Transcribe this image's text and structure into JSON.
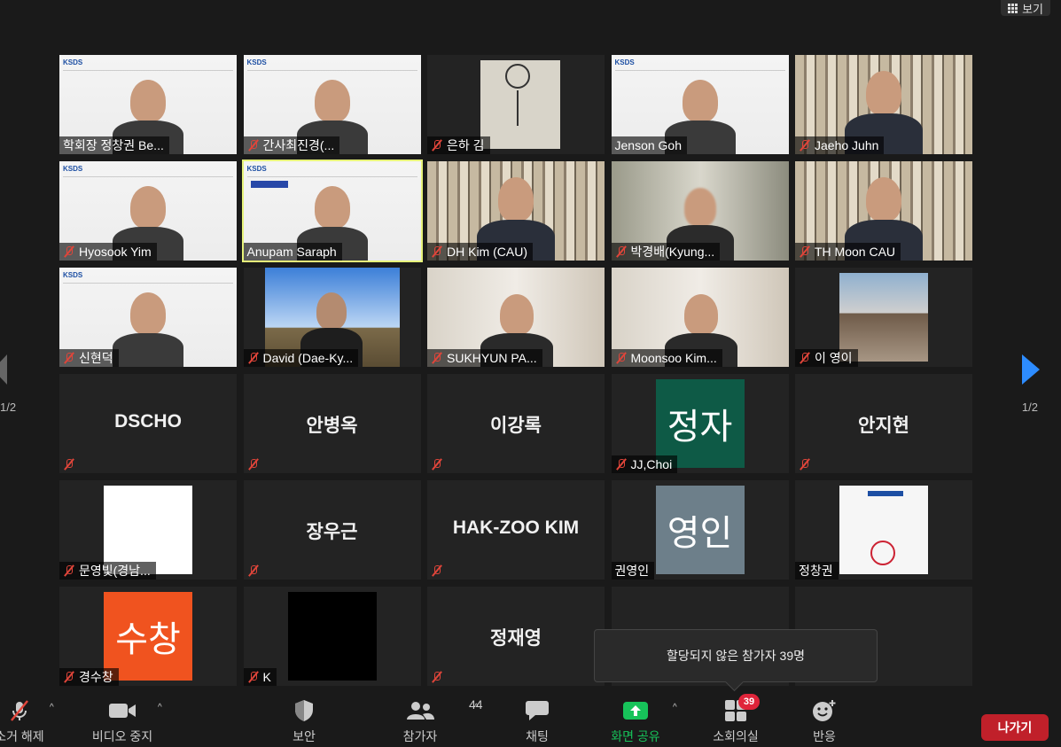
{
  "view_button": {
    "label": "보기"
  },
  "page_indicator": {
    "left": "1/2",
    "right": "1/2"
  },
  "tiles": [
    {
      "name": "학회장 정창권 Be...",
      "muted": false,
      "kind": "video"
    },
    {
      "name": "간사최진경(...",
      "muted": true,
      "kind": "video"
    },
    {
      "name": "은하 김",
      "muted": true,
      "kind": "video"
    },
    {
      "name": "Jenson Goh",
      "muted": false,
      "kind": "video"
    },
    {
      "name": "Jaeho Juhn",
      "muted": true,
      "kind": "video"
    },
    {
      "name": "Hyosook Yim",
      "muted": true,
      "kind": "video"
    },
    {
      "name": "Anupam Saraph",
      "muted": false,
      "kind": "video",
      "active": true
    },
    {
      "name": "DH Kim (CAU)",
      "muted": true,
      "kind": "video"
    },
    {
      "name": "박경배(Kyung...",
      "muted": true,
      "kind": "video"
    },
    {
      "name": "TH Moon CAU",
      "muted": true,
      "kind": "video"
    },
    {
      "name": "신현덕",
      "muted": true,
      "kind": "video"
    },
    {
      "name": "David (Dae-Ky...",
      "muted": true,
      "kind": "video"
    },
    {
      "name": "SUKHYUN PA...",
      "muted": true,
      "kind": "video"
    },
    {
      "name": "Moonsoo Kim...",
      "muted": true,
      "kind": "video"
    },
    {
      "name": "이 영이",
      "muted": true,
      "kind": "video"
    },
    {
      "name": "DSCHO",
      "muted": true,
      "kind": "text"
    },
    {
      "name": "안병옥",
      "muted": true,
      "kind": "text"
    },
    {
      "name": "이강록",
      "muted": true,
      "kind": "text"
    },
    {
      "name": "JJ,Choi",
      "muted": true,
      "kind": "avatar",
      "avatar": "정자",
      "color": "#0e5a46"
    },
    {
      "name": "안지현",
      "muted": true,
      "kind": "text"
    },
    {
      "name": "문영빛(경남...",
      "muted": true,
      "kind": "video"
    },
    {
      "name": "장우근",
      "muted": true,
      "kind": "text"
    },
    {
      "name": "HAK-ZOO KIM",
      "muted": true,
      "kind": "text"
    },
    {
      "name": "권영인",
      "muted": false,
      "kind": "avatar",
      "avatar": "영인",
      "color": "#6d7f8a"
    },
    {
      "name": "정창권",
      "muted": false,
      "kind": "video"
    },
    {
      "name": "경수창",
      "muted": true,
      "kind": "avatar",
      "avatar": "수창",
      "color": "#f0531f"
    },
    {
      "name": "K",
      "muted": true,
      "kind": "black"
    },
    {
      "name": "정재영",
      "muted": true,
      "kind": "text"
    },
    {
      "name": "",
      "muted": false,
      "kind": "text"
    },
    {
      "name": "",
      "muted": false,
      "kind": "text"
    }
  ],
  "tooltip": {
    "text": "할당되지 않은 참가자 39명"
  },
  "toolbar": {
    "mute_label": "소거 해제",
    "video_label": "비디오 중지",
    "security_label": "보안",
    "participants_label": "참가자",
    "participants_count": "44",
    "chat_label": "채팅",
    "share_label": "화면 공유",
    "breakout_label": "소회의실",
    "breakout_badge": "39",
    "reactions_label": "반응",
    "leave_label": "나가기"
  },
  "colors": {
    "share_green": "#17c35a",
    "leave_red": "#c0202a",
    "accent_blue": "#2d8cff",
    "active_border": "#e6f27a"
  }
}
